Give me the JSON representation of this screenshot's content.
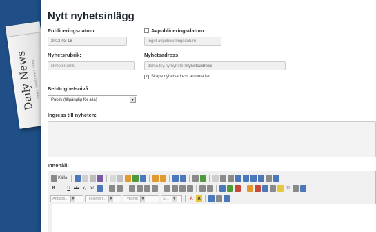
{
  "newspaper": {
    "masthead": "Daily News",
    "tagline": "news news news news"
  },
  "page": {
    "title": "Nytt nyhetsinlägg"
  },
  "form": {
    "pubdate_label": "Publiceringsdatum:",
    "pubdate_value": "2013-03-18",
    "unpub_label": "Avpubliceringsdatum:",
    "unpub_placeholder": "Inget avpubliceringsdatum",
    "headline_label": "Nyhetsrubrik:",
    "headline_placeholder": "Nyhetsrubrik",
    "address_label": "Nyhetsadress:",
    "address_prefix": "demo.fsy.ny/nyheter/",
    "address_value": "nyhetsadress",
    "auto_address_label": "Skapa nyhetsadress automatiskt",
    "permission_label": "Behörighetsnivå:",
    "permission_value": "Publik (tillgänglig för alla)",
    "intro_label": "Ingress till nyheten:",
    "content_label": "Innehåll:"
  },
  "editor": {
    "source_label": "Källa",
    "bold": "B",
    "italic": "I",
    "underline": "U",
    "strike": "abc",
    "sub": "x₂",
    "sup": "x²",
    "format_placeholder": "Anpass...",
    "font_placeholder": "Teckensn...",
    "size_placeholder": "Typsnitt",
    "style_placeholder": "St...",
    "text_color": "A",
    "bg_color": "A",
    "icon_colors": {
      "blue": "#4a78b8",
      "green": "#4f9a3a",
      "red": "#c64a3a",
      "orange": "#e09a30",
      "yellow": "#e6c83c",
      "gray": "#8a8a8a",
      "purple": "#7a5aa6"
    }
  }
}
